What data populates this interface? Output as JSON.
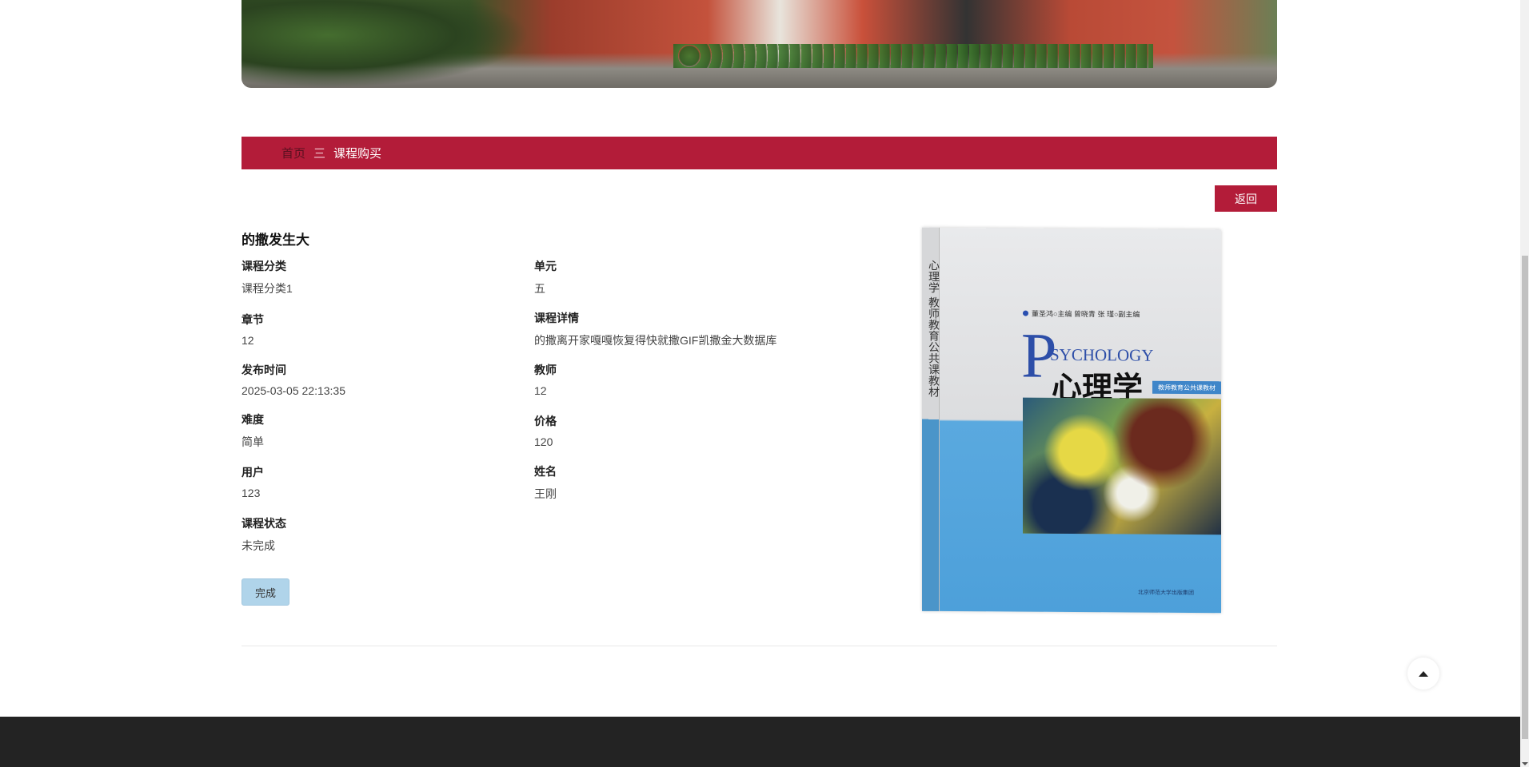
{
  "breadcrumb": {
    "home": "首页",
    "separator": "三",
    "current": "课程购买"
  },
  "back_label": "返回",
  "course": {
    "title": "的撒发生大",
    "fields": [
      {
        "label": "课程分类",
        "value": "课程分类1"
      },
      {
        "label": "单元",
        "value": "五"
      },
      {
        "label": "章节",
        "value": "12"
      },
      {
        "label": "课程详情",
        "value": "的撒离开家嘎嘎恢复得快就撒GIF凯撒金大数据库"
      },
      {
        "label": "发布时间",
        "value": "2025-03-05 22:13:35"
      },
      {
        "label": "教师",
        "value": "12"
      },
      {
        "label": "难度",
        "value": "简单"
      },
      {
        "label": "价格",
        "value": "120"
      },
      {
        "label": "用户",
        "value": "123"
      },
      {
        "label": "姓名",
        "value": "王刚"
      },
      {
        "label": "课程状态",
        "value": "未完成"
      }
    ],
    "complete_label": "完成"
  },
  "book_cover": {
    "english": "SYCHOLOGY",
    "big_letter": "P",
    "title_cn": "心理学",
    "spine": "心理学 教师教育公共课教材",
    "authors": "董圣鸿○主编  曾晓青 张 瑾○副主编",
    "tag": "教师教育公共课教材",
    "publisher": "北京师范大学出版集团"
  },
  "colors": {
    "accent": "#b31c39",
    "complete_button": "#b0d4ea",
    "footer": "#232323"
  },
  "icons": {
    "back_to_top": "triangle-up-icon"
  }
}
